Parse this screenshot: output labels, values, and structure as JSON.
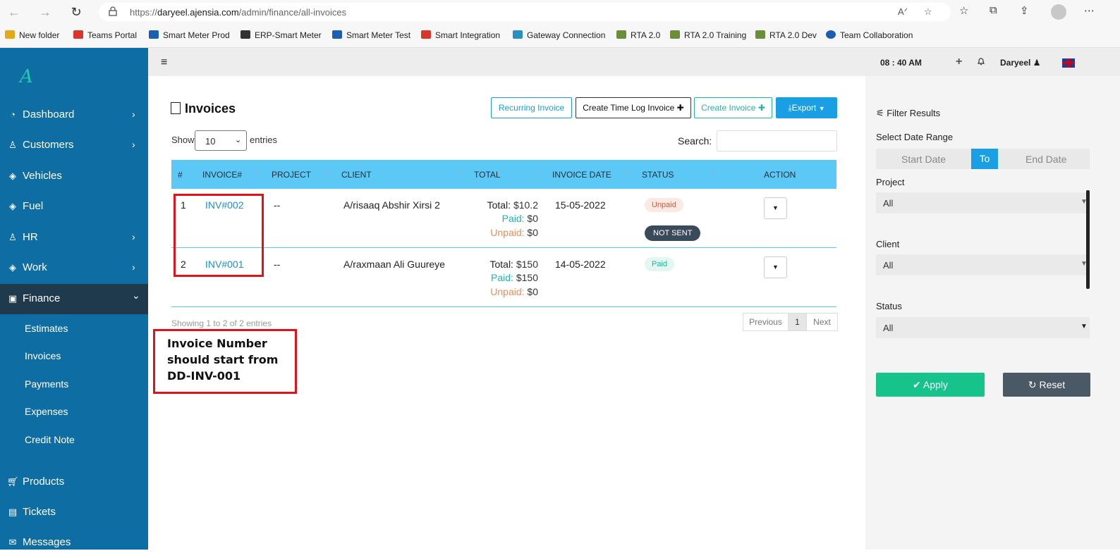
{
  "browser": {
    "url_prefix": "https://",
    "url_host": "daryeel.ajensia.com",
    "url_path": "/admin/finance/all-invoices",
    "bookmarks": [
      {
        "label": "New folder",
        "color": "#e6a817"
      },
      {
        "label": "Teams Portal",
        "color": "#d9362b"
      },
      {
        "label": "Smart Meter Prod",
        "color": "#1a5fb4"
      },
      {
        "label": "ERP-Smart Meter",
        "color": "#333333"
      },
      {
        "label": "Smart Meter Test",
        "color": "#1a5fb4"
      },
      {
        "label": "Smart Integration",
        "color": "#d9362b"
      },
      {
        "label": "Gateway Connection",
        "color": "#2a8fc1"
      },
      {
        "label": "RTA 2.0",
        "color": "#6b8e3a"
      },
      {
        "label": "RTA 2.0 Training",
        "color": "#6b8e3a"
      },
      {
        "label": "RTA 2.0 Dev",
        "color": "#6b8e3a"
      },
      {
        "label": "Team Collaboration",
        "color": "#1a5fb4"
      }
    ]
  },
  "sidebar": {
    "items": [
      {
        "label": "Dashboard",
        "icon": "dashboard-icon",
        "chevron": "›"
      },
      {
        "label": "Customers",
        "icon": "user-icon",
        "chevron": "›"
      },
      {
        "label": "Vehicles",
        "icon": "layers-icon",
        "chevron": ""
      },
      {
        "label": "Fuel",
        "icon": "layers-icon",
        "chevron": ""
      },
      {
        "label": "HR",
        "icon": "user-icon",
        "chevron": "›"
      },
      {
        "label": "Work",
        "icon": "layers-icon",
        "chevron": "›"
      },
      {
        "label": "Finance",
        "icon": "money-icon",
        "chevron": "⌄"
      }
    ],
    "subitems": [
      "Estimates",
      "Invoices",
      "Payments",
      "Expenses",
      "Credit Note"
    ],
    "bottom_items": [
      {
        "label": "Products",
        "icon": "cart-icon"
      },
      {
        "label": "Tickets",
        "icon": "ticket-icon"
      },
      {
        "label": "Messages",
        "icon": "message-icon"
      }
    ]
  },
  "header": {
    "time": "08 : 40 AM",
    "user": "Daryeel"
  },
  "page": {
    "title": "Invoices",
    "buttons": {
      "recurring": "Recurring Invoice",
      "time_log": "Create Time Log Invoice",
      "create": "Create Invoice",
      "export": "Export"
    },
    "show": "Show",
    "entries_value": "10",
    "entries": "entries",
    "search_label": "Search:"
  },
  "table": {
    "columns": [
      "#",
      "INVOICE#",
      "PROJECT",
      "CLIENT",
      "TOTAL",
      "INVOICE DATE",
      "STATUS",
      "ACTION"
    ],
    "rows": [
      {
        "num": "1",
        "invoice": "INV#002",
        "project": "--",
        "client": "A/risaaq Abshir Xirsi 2",
        "total_label": "Total:",
        "total": "$10.2",
        "paid_label": "Paid:",
        "paid": "$0",
        "unpaid_label": "Unpaid:",
        "unpaid": "$0",
        "date": "15-05-2022",
        "status": "Unpaid",
        "sent": "NOT SENT"
      },
      {
        "num": "2",
        "invoice": "INV#001",
        "project": "--",
        "client": "A/raxmaan Ali Guureye",
        "total_label": "Total:",
        "total": "$150",
        "paid_label": "Paid:",
        "paid": "$150",
        "unpaid_label": "Unpaid:",
        "unpaid": "$0",
        "date": "14-05-2022",
        "status": "Paid",
        "sent": ""
      }
    ],
    "showing": "Showing 1 to 2 of 2 entries",
    "pagination": {
      "previous": "Previous",
      "current": "1",
      "next": "Next"
    }
  },
  "annotation": {
    "note": "Invoice Number should start from DD-INV-001",
    "color": "#e0131a"
  },
  "filter": {
    "title": "Filter Results",
    "date_range_label": "Select Date Range",
    "start_date": "Start Date",
    "to": "To",
    "end_date": "End Date",
    "project_label": "Project",
    "project_value": "All",
    "client_label": "Client",
    "client_value": "All",
    "status_label": "Status",
    "status_value": "All",
    "apply": "Apply",
    "reset": "Reset"
  },
  "colors": {
    "sidebar": "#0e6ea4",
    "accent": "#1a9fe4",
    "table_header": "#5bc8f5",
    "apply": "#16c38a"
  }
}
